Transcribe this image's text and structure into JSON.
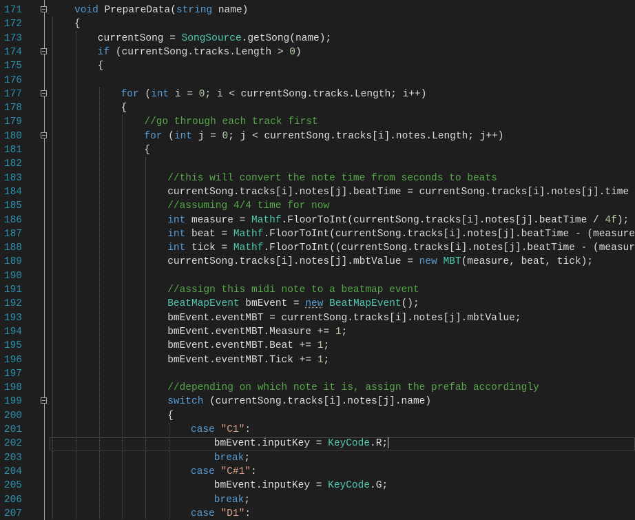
{
  "editor": {
    "top_partial": "// ...",
    "lines": [
      {
        "n": "171",
        "fold": true,
        "tokens": [
          [
            "kw",
            "void"
          ],
          [
            "pl",
            " PrepareData("
          ],
          [
            "kw",
            "string"
          ],
          [
            "pl",
            " name)"
          ]
        ],
        "indent": 1
      },
      {
        "n": "172",
        "fold": false,
        "tokens": [
          [
            "pl",
            "{"
          ]
        ],
        "indent": 1
      },
      {
        "n": "173",
        "fold": false,
        "tokens": [
          [
            "pl",
            "currentSong = "
          ],
          [
            "ty",
            "SongSource"
          ],
          [
            "pl",
            ".getSong(name);"
          ]
        ],
        "indent": 2
      },
      {
        "n": "174",
        "fold": true,
        "tokens": [
          [
            "kw",
            "if"
          ],
          [
            "pl",
            " (currentSong.tracks.Length > "
          ],
          [
            "nm",
            "0"
          ],
          [
            "pl",
            ")"
          ]
        ],
        "indent": 2
      },
      {
        "n": "175",
        "fold": false,
        "tokens": [
          [
            "pl",
            "{"
          ]
        ],
        "indent": 2
      },
      {
        "n": "176",
        "fold": false,
        "tokens": [],
        "indent": 2
      },
      {
        "n": "177",
        "fold": true,
        "tokens": [
          [
            "kw",
            "for"
          ],
          [
            "pl",
            " ("
          ],
          [
            "kw",
            "int"
          ],
          [
            "pl",
            " i = "
          ],
          [
            "nm",
            "0"
          ],
          [
            "pl",
            "; i < currentSong.tracks.Length; i++)"
          ]
        ],
        "indent": 3
      },
      {
        "n": "178",
        "fold": false,
        "tokens": [
          [
            "pl",
            "{"
          ]
        ],
        "indent": 3
      },
      {
        "n": "179",
        "fold": false,
        "tokens": [
          [
            "cm",
            "//go through each track first"
          ]
        ],
        "indent": 4
      },
      {
        "n": "180",
        "fold": true,
        "tokens": [
          [
            "kw",
            "for"
          ],
          [
            "pl",
            " ("
          ],
          [
            "kw",
            "int"
          ],
          [
            "pl",
            " j = "
          ],
          [
            "nm",
            "0"
          ],
          [
            "pl",
            "; j < currentSong.tracks[i].notes.Length; j++)"
          ]
        ],
        "indent": 4
      },
      {
        "n": "181",
        "fold": false,
        "tokens": [
          [
            "pl",
            "{"
          ]
        ],
        "indent": 4
      },
      {
        "n": "182",
        "fold": false,
        "tokens": [],
        "indent": 4
      },
      {
        "n": "183",
        "fold": false,
        "tokens": [
          [
            "cm",
            "//this will convert the note time from seconds to beats"
          ]
        ],
        "indent": 5
      },
      {
        "n": "184",
        "fold": false,
        "tokens": [
          [
            "pl",
            "currentSong.tracks[i].notes[j].beatTime = currentSong.tracks[i].notes[j].time *"
          ]
        ],
        "indent": 5
      },
      {
        "n": "185",
        "fold": false,
        "tokens": [
          [
            "cm",
            "//assuming 4/4 time for now"
          ]
        ],
        "indent": 5
      },
      {
        "n": "186",
        "fold": false,
        "tokens": [
          [
            "kw",
            "int"
          ],
          [
            "pl",
            " measure = "
          ],
          [
            "ty",
            "Mathf"
          ],
          [
            "pl",
            ".FloorToInt(currentSong.tracks[i].notes[j].beatTime / "
          ],
          [
            "nm",
            "4f"
          ],
          [
            "pl",
            ");"
          ]
        ],
        "indent": 5
      },
      {
        "n": "187",
        "fold": false,
        "tokens": [
          [
            "kw",
            "int"
          ],
          [
            "pl",
            " beat = "
          ],
          [
            "ty",
            "Mathf"
          ],
          [
            "pl",
            ".FloorToInt(currentSong.tracks[i].notes[j].beatTime - (measure"
          ]
        ],
        "indent": 5
      },
      {
        "n": "188",
        "fold": false,
        "tokens": [
          [
            "kw",
            "int"
          ],
          [
            "pl",
            " tick = "
          ],
          [
            "ty",
            "Mathf"
          ],
          [
            "pl",
            ".FloorToInt((currentSong.tracks[i].notes[j].beatTime - (measure"
          ]
        ],
        "indent": 5
      },
      {
        "n": "189",
        "fold": false,
        "tokens": [
          [
            "pl",
            "currentSong.tracks[i].notes[j].mbtValue = "
          ],
          [
            "kw",
            "new"
          ],
          [
            "pl",
            " "
          ],
          [
            "ty",
            "MBT"
          ],
          [
            "pl",
            "(measure, beat, tick);"
          ]
        ],
        "indent": 5
      },
      {
        "n": "190",
        "fold": false,
        "tokens": [],
        "indent": 5
      },
      {
        "n": "191",
        "fold": false,
        "tokens": [
          [
            "cm",
            "//assign this midi note to a beatmap event"
          ]
        ],
        "indent": 5
      },
      {
        "n": "192",
        "fold": false,
        "tokens": [
          [
            "ty",
            "BeatMapEvent"
          ],
          [
            "pl",
            " bmEvent = "
          ],
          [
            "kw",
            "new"
          ],
          [
            "pl",
            " "
          ],
          [
            "ty",
            "BeatMapEvent"
          ],
          [
            "pl",
            "();"
          ]
        ],
        "indent": 5
      },
      {
        "n": "193",
        "fold": false,
        "tokens": [
          [
            "pl",
            "bmEvent.eventMBT = currentSong.tracks[i].notes[j].mbtValue;"
          ]
        ],
        "indent": 5
      },
      {
        "n": "194",
        "fold": false,
        "tokens": [
          [
            "pl",
            "bmEvent.eventMBT.Measure += "
          ],
          [
            "nm",
            "1"
          ],
          [
            "pl",
            ";"
          ]
        ],
        "indent": 5
      },
      {
        "n": "195",
        "fold": false,
        "tokens": [
          [
            "pl",
            "bmEvent.eventMBT.Beat += "
          ],
          [
            "nm",
            "1"
          ],
          [
            "pl",
            ";"
          ]
        ],
        "indent": 5
      },
      {
        "n": "196",
        "fold": false,
        "tokens": [
          [
            "pl",
            "bmEvent.eventMBT.Tick += "
          ],
          [
            "nm",
            "1"
          ],
          [
            "pl",
            ";"
          ]
        ],
        "indent": 5
      },
      {
        "n": "197",
        "fold": false,
        "tokens": [],
        "indent": 5
      },
      {
        "n": "198",
        "fold": false,
        "tokens": [
          [
            "cm",
            "//depending on which note it is, assign the prefab accordingly"
          ]
        ],
        "indent": 5
      },
      {
        "n": "199",
        "fold": true,
        "tokens": [
          [
            "kw",
            "switch"
          ],
          [
            "pl",
            " (currentSong.tracks[i].notes[j].name)"
          ]
        ],
        "indent": 5
      },
      {
        "n": "200",
        "fold": false,
        "tokens": [
          [
            "pl",
            "{"
          ]
        ],
        "indent": 5
      },
      {
        "n": "201",
        "fold": false,
        "tokens": [
          [
            "kw",
            "case"
          ],
          [
            "pl",
            " "
          ],
          [
            "st",
            "\"C1\""
          ],
          [
            "pl",
            ":"
          ]
        ],
        "indent": 6
      },
      {
        "n": "202",
        "fold": false,
        "tokens": [
          [
            "pl",
            "bmEvent.inputKey = "
          ],
          [
            "ty",
            "KeyCode"
          ],
          [
            "pl",
            ".R;"
          ]
        ],
        "indent": 7,
        "current": true
      },
      {
        "n": "203",
        "fold": false,
        "tokens": [
          [
            "kw",
            "break"
          ],
          [
            "pl",
            ";"
          ]
        ],
        "indent": 7
      },
      {
        "n": "204",
        "fold": false,
        "tokens": [
          [
            "kw",
            "case"
          ],
          [
            "pl",
            " "
          ],
          [
            "st",
            "\"C#1\""
          ],
          [
            "pl",
            ":"
          ]
        ],
        "indent": 6
      },
      {
        "n": "205",
        "fold": false,
        "tokens": [
          [
            "pl",
            "bmEvent.inputKey = "
          ],
          [
            "ty",
            "KeyCode"
          ],
          [
            "pl",
            ".G;"
          ]
        ],
        "indent": 7
      },
      {
        "n": "206",
        "fold": false,
        "tokens": [
          [
            "kw",
            "break"
          ],
          [
            "pl",
            ";"
          ]
        ],
        "indent": 7
      },
      {
        "n": "207",
        "fold": false,
        "tokens": [
          [
            "kw",
            "case"
          ],
          [
            "pl",
            " "
          ],
          [
            "st",
            "\"D1\""
          ],
          [
            "pl",
            ":"
          ]
        ],
        "indent": 6
      }
    ]
  }
}
